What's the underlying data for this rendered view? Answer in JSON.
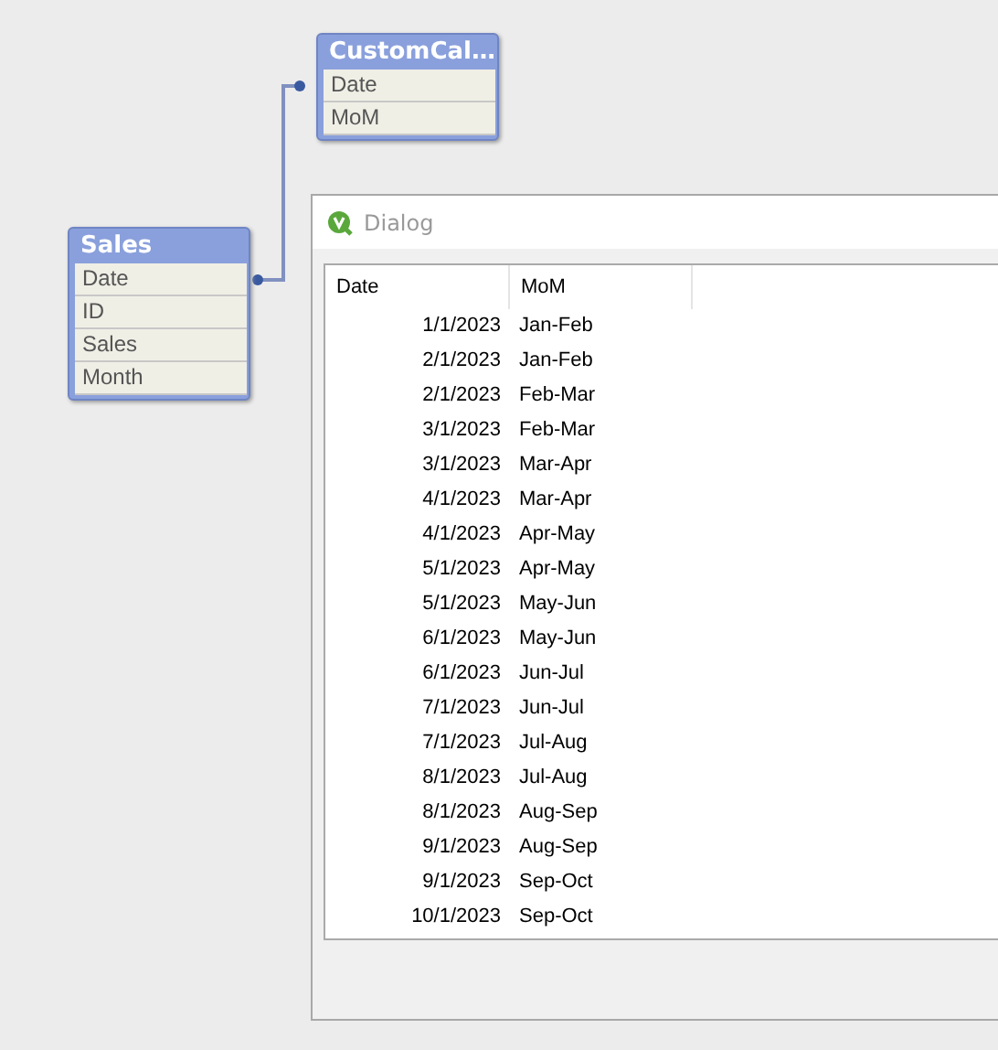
{
  "tables": [
    {
      "title": "Sales",
      "fields": [
        "Date",
        "ID",
        "Sales",
        "Month"
      ]
    },
    {
      "title": "CustomCal…",
      "fields": [
        "Date",
        "MoM"
      ]
    }
  ],
  "dialog": {
    "title": "Dialog",
    "columns": [
      "Date",
      "MoM"
    ],
    "rows": [
      [
        "1/1/2023",
        "Jan-Feb"
      ],
      [
        "2/1/2023",
        "Jan-Feb"
      ],
      [
        "2/1/2023",
        "Feb-Mar"
      ],
      [
        "3/1/2023",
        "Feb-Mar"
      ],
      [
        "3/1/2023",
        "Mar-Apr"
      ],
      [
        "4/1/2023",
        "Mar-Apr"
      ],
      [
        "4/1/2023",
        "Apr-May"
      ],
      [
        "5/1/2023",
        "Apr-May"
      ],
      [
        "5/1/2023",
        "May-Jun"
      ],
      [
        "6/1/2023",
        "May-Jun"
      ],
      [
        "6/1/2023",
        "Jun-Jul"
      ],
      [
        "7/1/2023",
        "Jun-Jul"
      ],
      [
        "7/1/2023",
        "Jul-Aug"
      ],
      [
        "8/1/2023",
        "Jul-Aug"
      ],
      [
        "8/1/2023",
        "Aug-Sep"
      ],
      [
        "9/1/2023",
        "Aug-Sep"
      ],
      [
        "9/1/2023",
        "Sep-Oct"
      ],
      [
        "10/1/2023",
        "Sep-Oct"
      ]
    ]
  }
}
